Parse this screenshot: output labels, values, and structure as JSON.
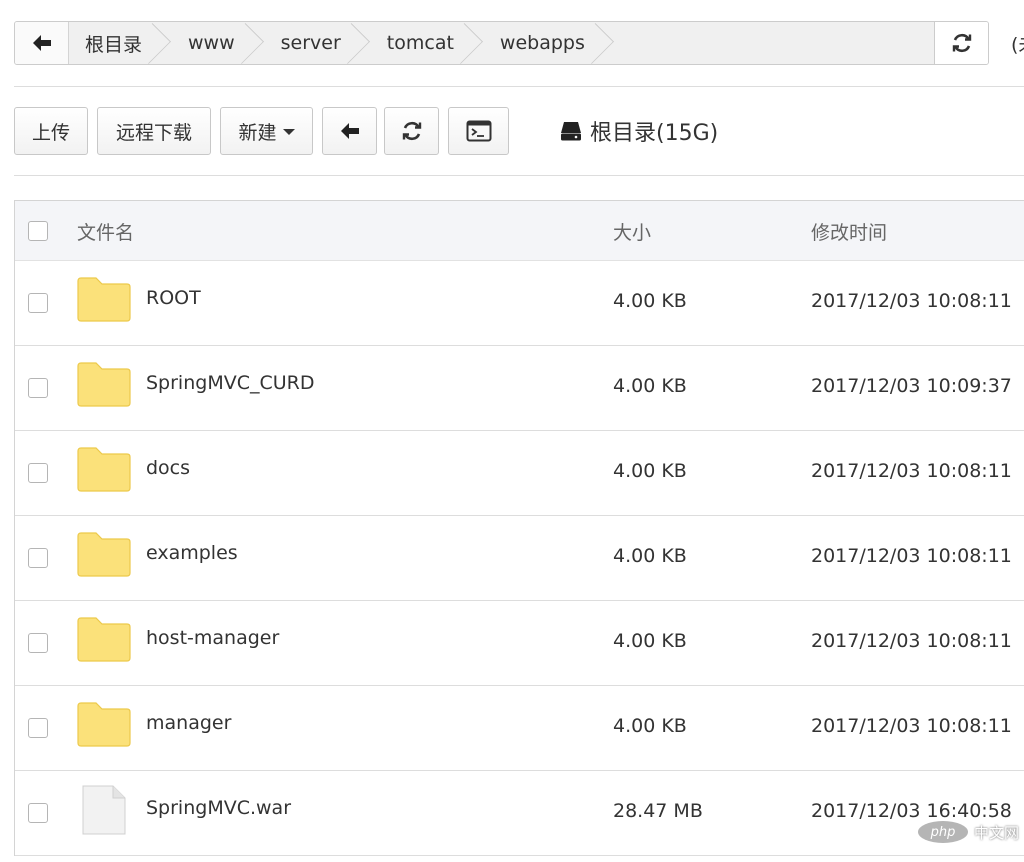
{
  "breadcrumb": {
    "items": [
      "根目录",
      "www",
      "server",
      "tomcat",
      "webapps"
    ],
    "truncated_text": "(未"
  },
  "toolbar": {
    "upload_label": "上传",
    "remote_download_label": "远程下载",
    "new_label": "新建",
    "disk_label": "根目录(15G)"
  },
  "table": {
    "headers": {
      "name": "文件名",
      "size": "大小",
      "mtime": "修改时间"
    },
    "rows": [
      {
        "name": "ROOT",
        "size": "4.00 KB",
        "mtime": "2017/12/03 10:08:11",
        "type": "folder"
      },
      {
        "name": "SpringMVC_CURD",
        "size": "4.00 KB",
        "mtime": "2017/12/03 10:09:37",
        "type": "folder"
      },
      {
        "name": "docs",
        "size": "4.00 KB",
        "mtime": "2017/12/03 10:08:11",
        "type": "folder"
      },
      {
        "name": "examples",
        "size": "4.00 KB",
        "mtime": "2017/12/03 10:08:11",
        "type": "folder"
      },
      {
        "name": "host-manager",
        "size": "4.00 KB",
        "mtime": "2017/12/03 10:08:11",
        "type": "folder"
      },
      {
        "name": "manager",
        "size": "4.00 KB",
        "mtime": "2017/12/03 10:08:11",
        "type": "folder"
      },
      {
        "name": "SpringMVC.war",
        "size": "28.47 MB",
        "mtime": "2017/12/03 16:40:58",
        "type": "file"
      }
    ]
  },
  "watermark": {
    "badge": "php",
    "text": "中文网"
  },
  "colors": {
    "folder": "#fbe17a",
    "folder_border": "#ecc94b",
    "header_bg": "#f4f5f8",
    "border": "#dddddd"
  }
}
